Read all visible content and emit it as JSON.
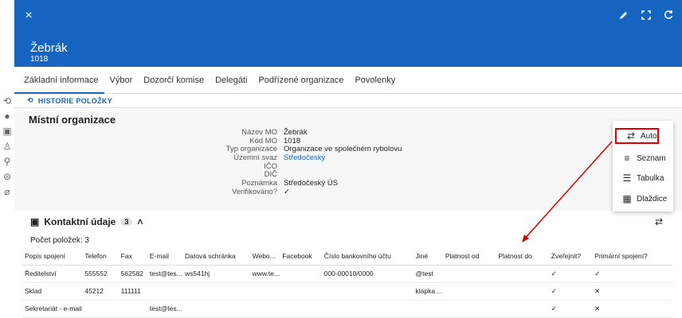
{
  "header": {
    "title": "Žebrák",
    "subtitle": "1018",
    "close_icon": "×"
  },
  "tabs": [
    "Základní informace",
    "Výbor",
    "Dozorčí komise",
    "Delegáti",
    "Podřízené organizace",
    "Povolenky"
  ],
  "history": "HISTORIE POLOŽKY",
  "section": {
    "title": "Místní organizace"
  },
  "details": [
    {
      "label": "Název MO",
      "value": "Žebrák"
    },
    {
      "label": "Kód MO",
      "value": "1018"
    },
    {
      "label": "Typ organizace",
      "value": "Organizace ve společném rybolovu"
    },
    {
      "label": "Územní svaz",
      "value": "Středočeský"
    },
    {
      "label": "IČO",
      "value": ""
    },
    {
      "label": "DIČ",
      "value": ""
    },
    {
      "label": "Poznámka",
      "value": "Středočeský ÚS"
    },
    {
      "label": "Verifikováno?",
      "value": "✓"
    }
  ],
  "menu": [
    {
      "label": "Auto",
      "icon": "⇄"
    },
    {
      "label": "Seznam",
      "icon": "≡"
    },
    {
      "label": "Tabulka",
      "icon": "☰"
    },
    {
      "label": "Dlaždice",
      "icon": "▦"
    }
  ],
  "contacts": {
    "title": "Kontaktní údaje",
    "badge": "3",
    "count_label": "Počet položek: 3",
    "columns": [
      "Popis spojení",
      "Telefon",
      "Fax",
      "E-mail",
      "Datová schránka",
      "Webo...",
      "Facebook",
      "Číslo bankovního účtu",
      "Jiné",
      "Platnost od",
      "Platnost do",
      "Zveřejnit?",
      "Primární spojení?"
    ],
    "rows": [
      [
        "Ředitelství",
        "555552",
        "562582",
        "test@tes...",
        "ws541hj",
        "www.te...",
        "",
        "000-00010/0000",
        "@test",
        "",
        "",
        "✓",
        "✓"
      ],
      [
        "Sklad",
        "45212",
        "111111",
        "",
        "",
        "",
        "",
        "",
        "klapka ...",
        "",
        "",
        "✓",
        "✕"
      ],
      [
        "Sekretariát - e-mail",
        "",
        "",
        "test@tes...",
        "",
        "",
        "",
        "",
        "",
        "",
        "",
        "✓",
        "✕"
      ]
    ]
  },
  "colors": {
    "header": "#1565c0",
    "accent": "#1565c0",
    "annotation": "#dd0000"
  }
}
